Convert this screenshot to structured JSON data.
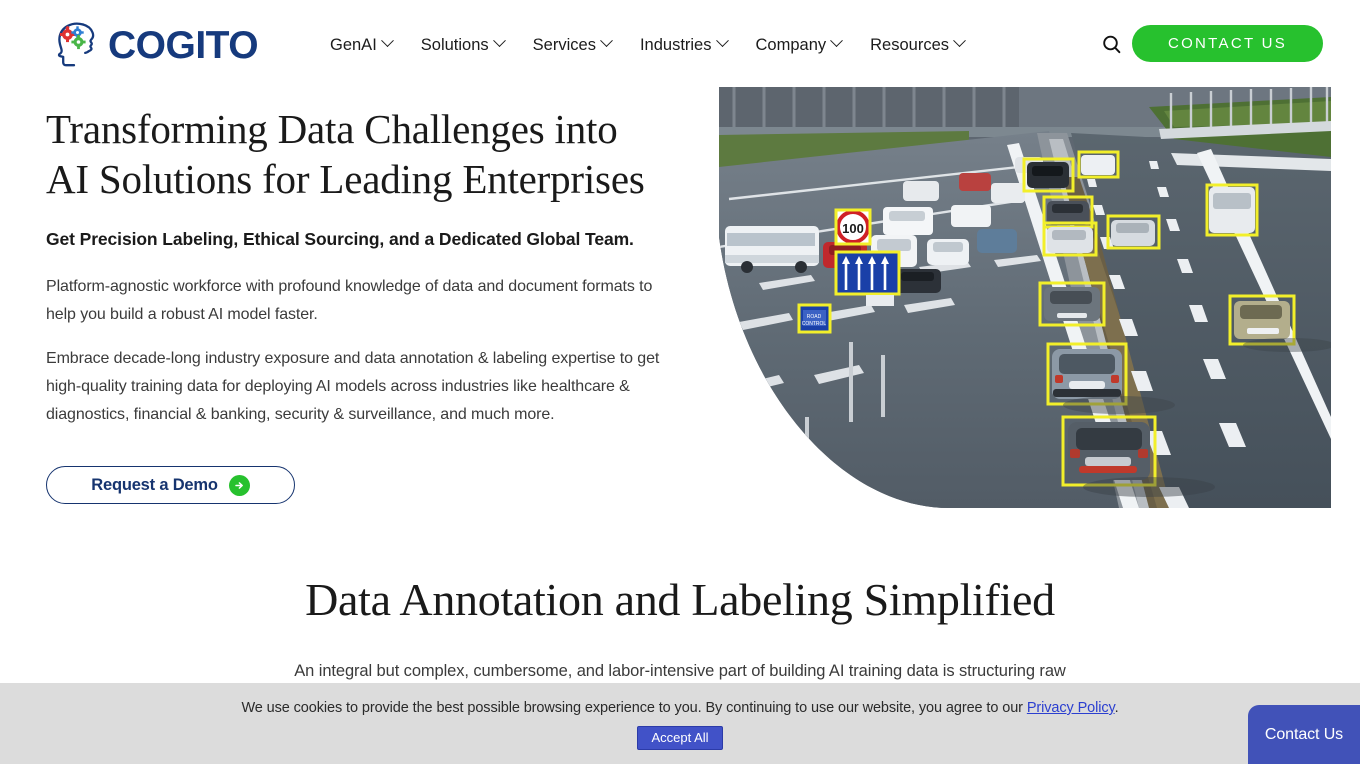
{
  "header": {
    "logo": {
      "icon": "brain-gears-head-icon",
      "wordmark": "COGITO",
      "colors": {
        "head": "#163a7d",
        "gear_red": "#e03232",
        "gear_blue": "#2f7fd4",
        "gear_green": "#49b648"
      }
    },
    "nav_items": [
      {
        "label": "GenAI",
        "has_dropdown": true
      },
      {
        "label": "Solutions",
        "has_dropdown": true
      },
      {
        "label": "Services",
        "has_dropdown": true
      },
      {
        "label": "Industries",
        "has_dropdown": true
      },
      {
        "label": "Company",
        "has_dropdown": true
      },
      {
        "label": "Resources",
        "has_dropdown": true
      }
    ],
    "search_icon": "search-icon",
    "contact_button": {
      "label": "CONTACT US",
      "color": "#27c12e"
    }
  },
  "hero": {
    "title_line1": "Transforming Data Challenges into",
    "title_line2": "AI Solutions for Leading Enterprises",
    "subtitle": "Get Precision Labeling, Ethical Sourcing, and a Dedicated Global Team.",
    "paragraph1": "Platform-agnostic workforce with profound knowledge of data and document formats to help you build a robust AI model faster.",
    "paragraph2": "Embrace decade-long industry exposure and data annotation & labeling expertise to get high-quality training data for deploying AI models across industries like healthcare & diagnostics, financial & banking, security & surveillance, and much more.",
    "cta": {
      "label": "Request a Demo",
      "icon": "arrow-right-circle-icon",
      "icon_color": "#27c12e",
      "border_color": "#16346f"
    },
    "image": {
      "alt": "Highway traffic scene with yellow object-detection bounding boxes on vehicles and road signs",
      "annotation_color": "#f2ef2a",
      "sign_speed_limit": "100",
      "sign_text": "ROAD CONTROL"
    }
  },
  "section2": {
    "title": "Data Annotation and Labeling Simplified",
    "paragraph": "An integral but complex, cumbersome, and labor-intensive part of building AI training data is structuring raw"
  },
  "cookie_banner": {
    "text_before": "We use cookies to provide the best possible browsing experience to you. By continuing to use our website, you agree to our ",
    "link_label": "Privacy Policy",
    "text_after": ".",
    "accept_label": "Accept All",
    "accept_color": "#4152c8",
    "background": "#dcdcdc"
  },
  "contact_tab": {
    "label": "Contact Us",
    "color": "#4152b8"
  }
}
